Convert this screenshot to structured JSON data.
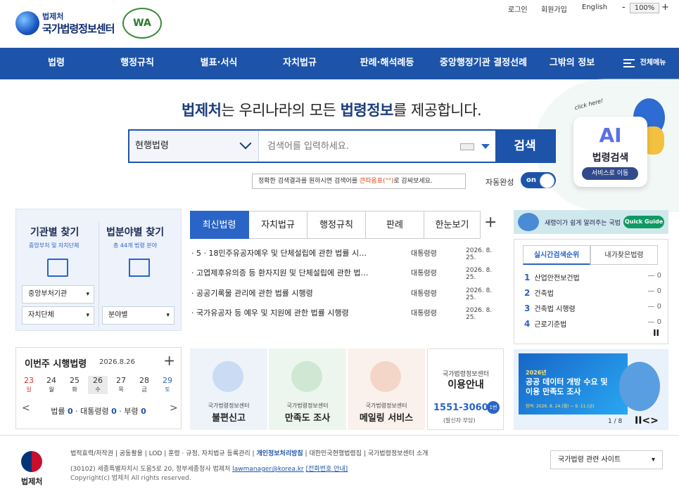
{
  "header": {
    "org_top": "법제처",
    "org_name": "국가법령정보센터",
    "wa_mark": "WA",
    "login": "로그인",
    "signup": "회원가입",
    "english": "English",
    "zoom_minus": "-",
    "zoom_value": "100%",
    "zoom_plus": "+"
  },
  "nav": {
    "items": [
      "법령",
      "행정규칙",
      "별표·서식",
      "자치법규",
      "판례·해석례등",
      "중앙행정기관 결정선례",
      "그밖의 정보"
    ],
    "all_menu": "전체메뉴"
  },
  "hero": {
    "head_a": "법제처",
    "head_b": "는 우리나라의 모든 ",
    "head_c": "법령정보",
    "head_d": "를 제공합니다."
  },
  "search": {
    "select_value": "현행법령",
    "placeholder": "검색어를 입력하세요.",
    "button": "검색",
    "tip_a": "정확한 검색결과를 원하시면 검색어를 ",
    "tip_b": "큰따옴표(\"\")",
    "tip_c": "로 감싸보세요.",
    "auto_label": "자동완성",
    "toggle": "on"
  },
  "ai": {
    "click": "click here!",
    "ai": "AI",
    "title": "법령검색",
    "button": "서비스로 이동"
  },
  "finder": {
    "left_title": "기관별 찾기",
    "left_sub": "중앙부처 및 자치단체",
    "right_title": "법분야별 찾기",
    "right_sub": "총 44개 법령 분야",
    "select1": "중앙부처기관",
    "select2": "자치단체",
    "select3": "분야별"
  },
  "week": {
    "title": "이번주 시행법령",
    "date": "2026.8.26",
    "plus": "+",
    "days": [
      {
        "num": "23",
        "label": "일"
      },
      {
        "num": "24",
        "label": "월"
      },
      {
        "num": "25",
        "label": "화"
      },
      {
        "num": "26",
        "label": "수"
      },
      {
        "num": "27",
        "label": "목"
      },
      {
        "num": "28",
        "label": "금"
      },
      {
        "num": "29",
        "label": "토"
      }
    ],
    "law_label": "법률",
    "law_count": "0",
    "pres_label": "대통령령",
    "pres_count": "0",
    "min_label": "부령",
    "min_count": "0"
  },
  "tabs": [
    "최신법령",
    "자치법규",
    "행정규칙",
    "판례",
    "한눈보기"
  ],
  "tab_plus": "+",
  "news": [
    {
      "title": "5 · 18민주유공자예우 및 단체설립에 관한 법률 시…",
      "kind": "대통령령",
      "date": "2026. 8. 25."
    },
    {
      "title": "고엽제후유의증 등 환자지원 및 단체설립에 관한 법…",
      "kind": "대통령령",
      "date": "2026. 8. 25."
    },
    {
      "title": "공공기록물 관리에 관한 법률 시행령",
      "kind": "대통령령",
      "date": "2026. 8. 25."
    },
    {
      "title": "국가유공자 등 예우 및 지원에 관한 법률 시행령",
      "kind": "대통령령",
      "date": "2026. 8. 25."
    }
  ],
  "services": [
    {
      "sub": "국가법령정보센터",
      "main": "불편신고"
    },
    {
      "sub": "국가법령정보센터",
      "main": "만족도 조사"
    },
    {
      "sub": "국가법령정보센터",
      "main": "메일링 서비스"
    }
  ],
  "info": {
    "a": "국가법령정보센터",
    "b": "이용안내",
    "phone": "1551-3060",
    "badge": "1번",
    "note": "(발신자 부담)"
  },
  "quick": {
    "text": "새령이가 쉽게 알려주는 국법",
    "button": "Quick Guide"
  },
  "rank": {
    "tab1": "실시간검색순위",
    "tab2": "내가찾은법령",
    "items": [
      {
        "n": "1",
        "name": "산업안전보건법",
        "v": "0"
      },
      {
        "n": "2",
        "name": "건축법",
        "v": "0"
      },
      {
        "n": "3",
        "name": "건축법 시행령",
        "v": "0"
      },
      {
        "n": "4",
        "name": "근로기준법",
        "v": "0"
      }
    ],
    "pause": "II"
  },
  "banner": {
    "year": "2026년",
    "l1": "공공 데이터 개방 수요 및",
    "l2": "이용 만족도 조사",
    "period": "참여: 2026. 8. 24.(월) ~ 9. 11.(금)",
    "page": "1 / 8",
    "ctl": "II<>"
  },
  "footer": {
    "logo_text": "법제처",
    "links": [
      "법적효력/저작권",
      "공동활용",
      "LOD",
      "훈령 · 규정, 자치법규 등록관리",
      "개인정보처리방침",
      "대한민국현행법령집",
      "국가법령정보센터 소개"
    ],
    "addr": "(30102) 세종특별자치시 도움5로 20, 정부세종청사 법제처 ",
    "email": "lawmanager@korea.kr",
    "phone_info": "[전화번호 안내]",
    "copyright": "Copyright(c) 법제처 All rights reserved.",
    "related": "국가법령 관련 사이트"
  },
  "colors": {
    "primary": "#1d54a9",
    "accent": "#2a64c6",
    "red": "#e04a1c"
  }
}
